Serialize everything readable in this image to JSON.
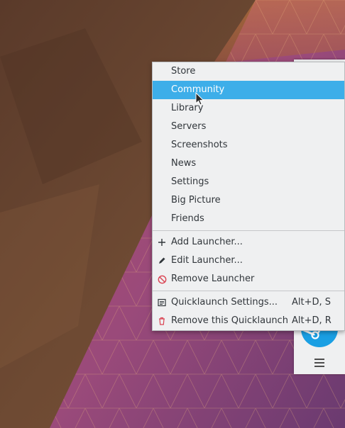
{
  "menu": {
    "items": [
      {
        "label": "Store"
      },
      {
        "label": "Community"
      },
      {
        "label": "Library"
      },
      {
        "label": "Servers"
      },
      {
        "label": "Screenshots"
      },
      {
        "label": "News"
      },
      {
        "label": "Settings"
      },
      {
        "label": "Big Picture"
      },
      {
        "label": "Friends"
      }
    ],
    "actions": [
      {
        "label": "Add Launcher...",
        "icon": "plus-icon"
      },
      {
        "label": "Edit Launcher...",
        "icon": "pencil-icon"
      },
      {
        "label": "Remove Launcher",
        "icon": "remove-circle-icon"
      }
    ],
    "quicklaunch": [
      {
        "label": "Quicklaunch Settings...",
        "shortcut": "Alt+D, S",
        "icon": "settings-panel-icon"
      },
      {
        "label": "Remove this Quicklaunch",
        "shortcut": "Alt+D, R",
        "icon": "trash-icon"
      }
    ],
    "highlighted": "Community"
  },
  "panel": {
    "icons": [
      "steam-icon",
      "hamburger-icon"
    ]
  },
  "colors": {
    "highlight": "#3daee9",
    "menu_bg": "#eff0f1",
    "text": "#31363b",
    "remove_red": "#da4453"
  }
}
